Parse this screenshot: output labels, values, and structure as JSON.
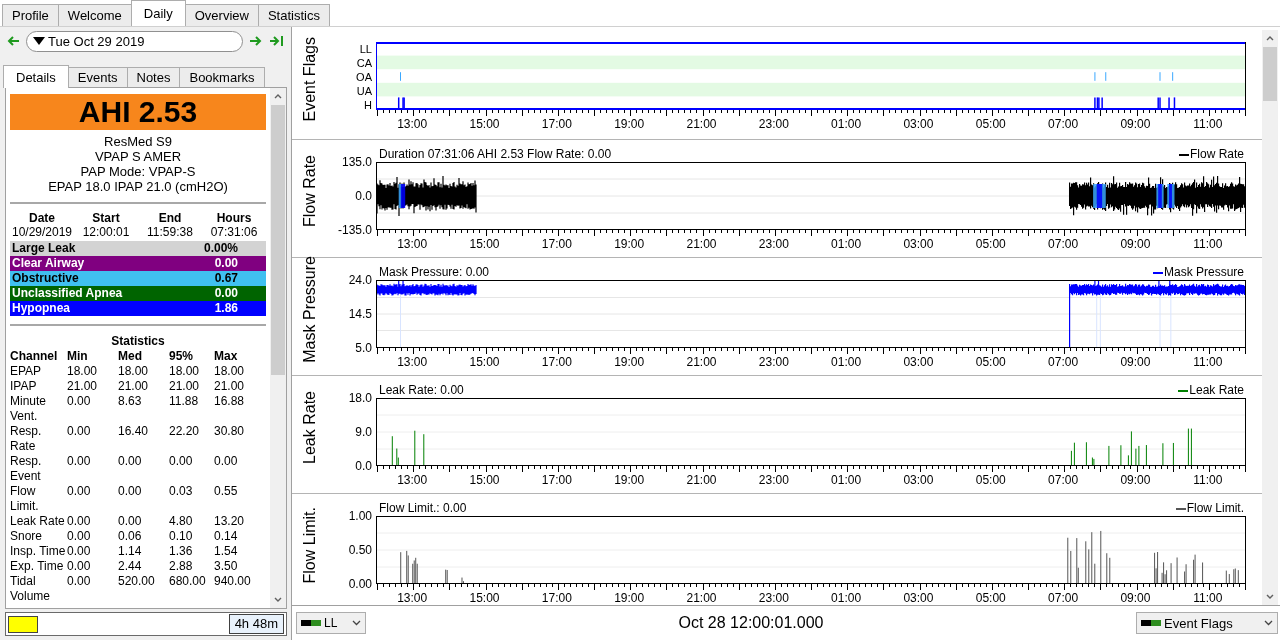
{
  "tabs": [
    {
      "label": "Profile",
      "selected": false
    },
    {
      "label": "Welcome",
      "selected": false
    },
    {
      "label": "Daily",
      "selected": true
    },
    {
      "label": "Overview",
      "selected": false
    },
    {
      "label": "Statistics",
      "selected": false
    }
  ],
  "date_nav": {
    "date": "Tue Oct 29 2019"
  },
  "detail_tabs": [
    {
      "label": "Details",
      "selected": true
    },
    {
      "label": "Events",
      "selected": false
    },
    {
      "label": "Notes",
      "selected": false
    },
    {
      "label": "Bookmarks",
      "selected": false
    }
  ],
  "summary": {
    "ahi": "AHI 2.53",
    "device_lines": [
      "ResMed S9",
      "VPAP S AMER",
      "PAP Mode: VPAP-S",
      "EPAP 18.0 IPAP 21.0 (cmH2O)"
    ]
  },
  "session": {
    "columns": [
      "Date",
      "Start",
      "End",
      "Hours"
    ],
    "values": [
      "10/29/2019",
      "12:00:01",
      "11:59:38",
      "07:31:06"
    ]
  },
  "event_rates": [
    {
      "name": "Large Leak",
      "value": "0.00%",
      "color": "#d3d3d3"
    },
    {
      "name": "Clear Airway",
      "value": "0.00",
      "color": "#800080"
    },
    {
      "name": "Obstructive",
      "value": "0.67",
      "color": "#40c0f0"
    },
    {
      "name": "Unclassified Apnea",
      "value": "0.00",
      "color": "#006400"
    },
    {
      "name": "Hypopnea",
      "value": "1.86",
      "color": "#0000ff"
    }
  ],
  "statistics": {
    "title": "Statistics",
    "columns": [
      "Channel",
      "Min",
      "Med",
      "95%",
      "Max"
    ],
    "rows": [
      [
        "EPAP",
        "18.00",
        "18.00",
        "18.00",
        "18.00"
      ],
      [
        "IPAP",
        "21.00",
        "21.00",
        "21.00",
        "21.00"
      ],
      [
        "Minute Vent.",
        "0.00",
        "8.63",
        "11.88",
        "16.88"
      ],
      [
        "Resp. Rate",
        "0.00",
        "16.40",
        "22.20",
        "30.80"
      ],
      [
        "Resp. Event",
        "0.00",
        "0.00",
        "0.00",
        "0.00"
      ],
      [
        "Flow Limit.",
        "0.00",
        "0.00",
        "0.03",
        "0.55"
      ],
      [
        "Leak Rate",
        "0.00",
        "0.00",
        "4.80",
        "13.20"
      ],
      [
        "Snore",
        "0.00",
        "0.06",
        "0.10",
        "0.14"
      ],
      [
        "Insp. Time",
        "0.00",
        "1.14",
        "1.36",
        "1.54"
      ],
      [
        "Exp. Time",
        "0.00",
        "2.44",
        "2.88",
        "3.50"
      ],
      [
        "Tidal Volume",
        "0.00",
        "520.00",
        "680.00",
        "940.00"
      ]
    ]
  },
  "time_bar": {
    "duration": "4h 48m"
  },
  "graphs": [
    {
      "kind": "flags",
      "label": "Event Flags",
      "rows": [
        "LL",
        "CA",
        "OA",
        "UA",
        "H"
      ],
      "xticks": [
        "13:00",
        "15:00",
        "17:00",
        "19:00",
        "21:00",
        "23:00",
        "01:00",
        "03:00",
        "05:00",
        "07:00",
        "09:00",
        "11:00"
      ]
    },
    {
      "kind": "wave",
      "label": "Flow Rate",
      "title": "Duration 07:31:06 AHI 2.53 Flow Rate: 0.00",
      "legend": "Flow Rate",
      "color": "#000000",
      "yticks": [
        "135.0",
        "0.0",
        "-135.0"
      ],
      "xticks": [
        "13:00",
        "15:00",
        "17:00",
        "19:00",
        "21:00",
        "23:00",
        "01:00",
        "03:00",
        "05:00",
        "07:00",
        "09:00",
        "11:00"
      ]
    },
    {
      "kind": "pressure",
      "label": "Mask Pressure",
      "title": "Mask Pressure: 0.00",
      "legend": "Mask Pressure",
      "color": "#0000ff",
      "yticks": [
        "24.0",
        "14.5",
        "5.0"
      ],
      "xticks": [
        "13:00",
        "15:00",
        "17:00",
        "19:00",
        "21:00",
        "23:00",
        "01:00",
        "03:00",
        "05:00",
        "07:00",
        "09:00",
        "11:00"
      ]
    },
    {
      "kind": "leak",
      "label": "Leak Rate",
      "title": "Leak Rate: 0.00",
      "legend": "Leak Rate",
      "color": "#008000",
      "yticks": [
        "18.0",
        "9.0",
        "0.0"
      ],
      "xticks": [
        "13:00",
        "15:00",
        "17:00",
        "19:00",
        "21:00",
        "23:00",
        "01:00",
        "03:00",
        "05:00",
        "07:00",
        "09:00",
        "11:00"
      ]
    },
    {
      "kind": "limit",
      "label": "Flow Limit.",
      "title": "Flow Limit.: 0.00",
      "legend": "Flow Limit.",
      "color": "#555555",
      "yticks": [
        "1.00",
        "0.50",
        "0.00"
      ],
      "xticks": [
        "13:00",
        "15:00",
        "17:00",
        "19:00",
        "21:00",
        "23:00",
        "01:00",
        "03:00",
        "05:00",
        "07:00",
        "09:00",
        "11:00"
      ]
    }
  ],
  "bottom_bar": {
    "left_select": "LL",
    "timestamp": "Oct 28 12:00:01.000",
    "right_select": "Event Flags"
  }
}
